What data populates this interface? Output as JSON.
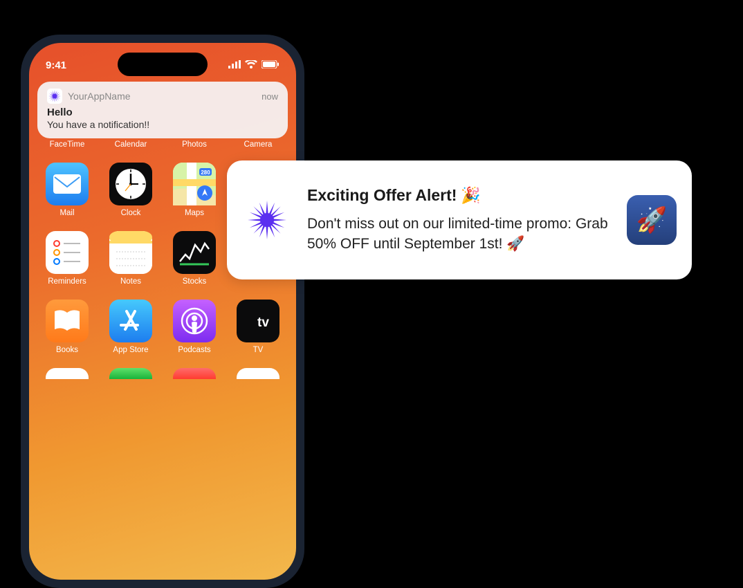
{
  "status": {
    "time": "9:41"
  },
  "notif": {
    "app_name": "YourAppName",
    "time": "now",
    "title": "Hello",
    "body": "You have a notification!!"
  },
  "apps": {
    "row1": [
      "FaceTime",
      "Calendar",
      "Photos",
      "Camera"
    ],
    "row2": [
      "Mail",
      "Clock",
      "Maps",
      ""
    ],
    "row3": [
      "Reminders",
      "Notes",
      "Stocks",
      ""
    ],
    "row4": [
      "Books",
      "App Store",
      "Podcasts",
      "TV"
    ]
  },
  "big": {
    "title": "Exciting Offer Alert!",
    "title_emoji": "🎉",
    "body": "Don't miss out on our limited-time promo: Grab 50% OFF until September 1st! 🚀"
  }
}
